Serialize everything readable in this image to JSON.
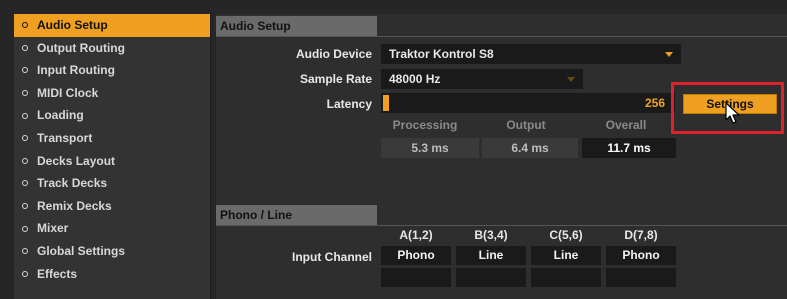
{
  "sidebar": {
    "items": [
      {
        "label": "Audio Setup",
        "active": true
      },
      {
        "label": "Output Routing"
      },
      {
        "label": "Input Routing"
      },
      {
        "label": "MIDI Clock"
      },
      {
        "label": "Loading"
      },
      {
        "label": "Transport"
      },
      {
        "label": "Decks Layout"
      },
      {
        "label": "Track Decks"
      },
      {
        "label": "Remix Decks"
      },
      {
        "label": "Mixer"
      },
      {
        "label": "Global Settings"
      },
      {
        "label": "Effects"
      }
    ]
  },
  "audio_setup": {
    "header": "Audio Setup",
    "audio_device_label": "Audio Device",
    "audio_device_value": "Traktor Kontrol S8",
    "sample_rate_label": "Sample Rate",
    "sample_rate_value": "48000 Hz",
    "latency_label": "Latency",
    "latency_value": "256",
    "settings_button": "Settings",
    "stats": {
      "processing_label": "Processing",
      "output_label": "Output",
      "overall_label": "Overall",
      "processing_value": "5.3 ms",
      "output_value": "6.4 ms",
      "overall_value": "11.7 ms"
    }
  },
  "phono_line": {
    "header": "Phono / Line",
    "input_channel_label": "Input Channel",
    "channels": [
      {
        "name": "A(1,2)",
        "value": "Phono"
      },
      {
        "name": "B(3,4)",
        "value": "Line"
      },
      {
        "name": "C(5,6)",
        "value": "Line"
      },
      {
        "name": "D(7,8)",
        "value": "Phono"
      }
    ]
  },
  "colors": {
    "accent": "#f0a020",
    "highlight": "#e0202a",
    "panel": "#2e2e2e",
    "field": "#1a1a1a"
  }
}
